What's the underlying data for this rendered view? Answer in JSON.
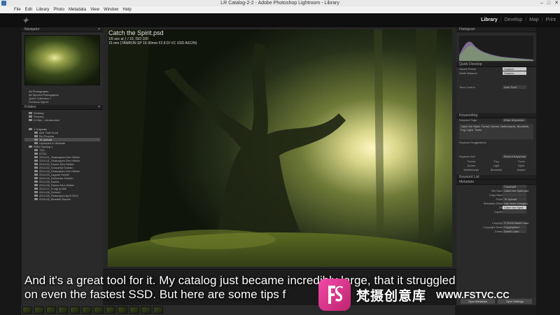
{
  "window": {
    "title": "LR Catalog-2-2 - Adobe Photoshop Lightroom - Library"
  },
  "menu": [
    "File",
    "Edit",
    "Library",
    "Photo",
    "Metadata",
    "View",
    "Window",
    "Help"
  ],
  "modules": {
    "library": "Library",
    "develop": "Develop",
    "map": "Map",
    "print": "Print"
  },
  "left_panel": {
    "navigator_label": "Navigator",
    "catalog_items": [
      "All Photographs",
      "All Synced Photographs",
      "Quick Collection +",
      "Previous Import"
    ],
    "folders_label": "Folders",
    "folder_rows": [
      {
        "label": "Desktop",
        "count": ""
      },
      {
        "label": "Pictures",
        "count": ""
      },
      {
        "label": "01 Byo - Introduction",
        "count": ""
      },
      {
        "label": "1 Originals",
        "count": ""
      },
      {
        "label": "Add That Good",
        "count": ""
      },
      {
        "label": "Re-Process",
        "count": ""
      },
      {
        "label": "To Upload",
        "count": ""
      },
      {
        "label": "Uploaded to Website",
        "count": ""
      },
      {
        "label": "RAW Catalog 1",
        "count": ""
      },
      {
        "label": "TSC",
        "count": ""
      },
      {
        "label": "DTSC",
        "count": ""
      },
      {
        "label": "2014-01_Seascapes Den Helder",
        "count": ""
      },
      {
        "label": "2014-01_Seascapes Den Helder",
        "count": ""
      },
      {
        "label": "2014-02_Dunes Den Helder",
        "count": ""
      },
      {
        "label": "2014-02_Schoorlse Duinen",
        "count": ""
      },
      {
        "label": "2014-03_Seascapes Den Helder",
        "count": ""
      },
      {
        "label": "2014-03_Lagune Helder",
        "count": ""
      },
      {
        "label": "2014-04_Schoorlse Duinen",
        "count": ""
      },
      {
        "label": "2014-05_Dunes",
        "count": ""
      },
      {
        "label": "2014-06_Dunes Den Helder",
        "count": ""
      },
      {
        "label": "2014-07_Fungi profile",
        "count": ""
      },
      {
        "label": "2014-08_Schoorl",
        "count": ""
      },
      {
        "label": "2014-09_Seascapes April 2014",
        "count": ""
      },
      {
        "label": "2016-05_Bluebell Woods",
        "count": ""
      }
    ]
  },
  "viewer": {
    "photo_title": "Catch the Spirit.psd",
    "exposure": "1/5 sec at ƒ / 10, ISO 100",
    "lens": "15 mm (TAMRON SP 15-30mm F2.8 DI VC USD A012N)"
  },
  "right_panel": {
    "histogram_label": "Histogram",
    "quick_develop_label": "Quick Develop",
    "saved_preset_label": "Saved Preset",
    "saved_preset_value": "Custom",
    "white_balance_label": "White Balance",
    "white_balance_value": "Custom",
    "tone_control_label": "Tone Control",
    "tone_control_value": "Auto Tone",
    "keywording_label": "Keywording",
    "keyword_tags_label": "Keyword Tags",
    "keyword_tags_value": "Enter Keywords",
    "keywords_text": "Catch the Spirit, Forest, Dunes, Netherlands, Bluebells, Fog, Light, Trees",
    "keyword_suggestions_label": "Keyword Suggestions",
    "keyword_set_label": "Keyword Set",
    "keyword_set_value": "Recent Keywords",
    "keyword_grid": [
      "Forest",
      "Fog",
      "Trees",
      "Dunes",
      "Light",
      "Spirit",
      "Netherlands",
      "Bluebells",
      "Nature"
    ],
    "keyword_list_label": "Keyword List",
    "metadata_label": "Metadata",
    "metadata_preset": "Copyright",
    "metadata_rows": [
      {
        "label": "File Name",
        "value": "Catch the Spirit.psd"
      },
      {
        "label": "Copy Name",
        "value": ""
      },
      {
        "label": "Folder",
        "value": "To Upload"
      },
      {
        "label": "Metadata Status",
        "value": "Has been changed"
      },
      {
        "label": "Title",
        "value": "Catch the Spirit"
      },
      {
        "label": "Caption",
        "value": ""
      }
    ],
    "copyright_rows": [
      {
        "label": "Copyright",
        "value": "© 2016 Daniel Laan"
      },
      {
        "label": "Copyright Status",
        "value": "Copyrighted"
      },
      {
        "label": "Creator",
        "value": "Daniel Laan"
      }
    ],
    "sync_metadata": "Sync Metadata",
    "sync_settings": "Sync Settings"
  },
  "subtitles": {
    "line1": "And it's a great tool for it. My catalog just became incredibly large, that it struggled",
    "line2": "on even the fastest SSD. But here are some tips f"
  },
  "watermark": {
    "brand_cn": "梵摄创意库",
    "url": "WWW.FSTVC.CC"
  }
}
